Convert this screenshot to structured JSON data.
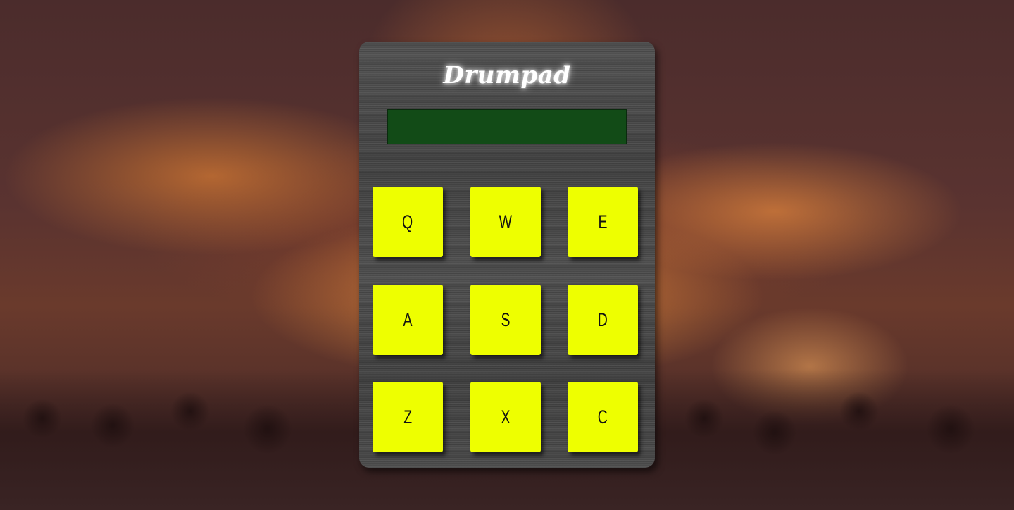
{
  "app": {
    "title": "Drumpad"
  },
  "display": {
    "text": ""
  },
  "pads": [
    {
      "key": "Q"
    },
    {
      "key": "W"
    },
    {
      "key": "E"
    },
    {
      "key": "A"
    },
    {
      "key": "S"
    },
    {
      "key": "D"
    },
    {
      "key": "Z"
    },
    {
      "key": "X"
    },
    {
      "key": "C"
    }
  ],
  "colors": {
    "pad": "#eeff00",
    "display": "#124b17",
    "panel": "#454545"
  }
}
